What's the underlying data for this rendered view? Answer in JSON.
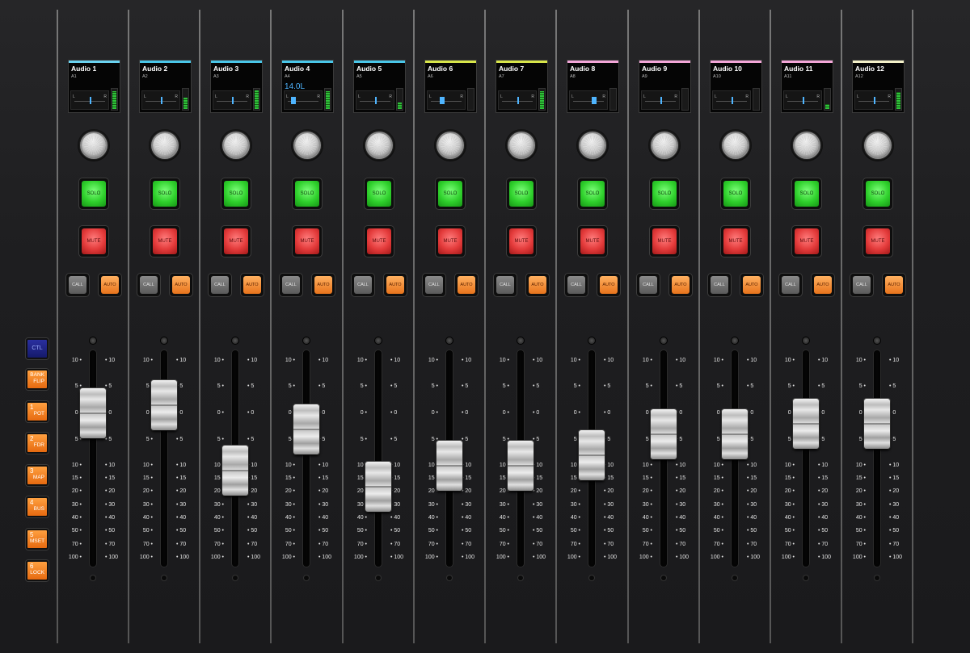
{
  "side_controls": {
    "ctl": "CTL",
    "buttons": [
      {
        "num": "",
        "label": "BANK\nFLIP"
      },
      {
        "num": "1",
        "label": "POT"
      },
      {
        "num": "2",
        "label": "FDR"
      },
      {
        "num": "3",
        "label": "MAP"
      },
      {
        "num": "4",
        "label": "BUS"
      },
      {
        "num": "5",
        "label": "MSET"
      },
      {
        "num": "6",
        "label": "LOCK"
      }
    ]
  },
  "fader_scale": [
    "10",
    "5",
    "0",
    "5",
    "10",
    "15",
    "20",
    "30",
    "40",
    "50",
    "70",
    "100"
  ],
  "labels": {
    "solo": "SOLO",
    "mute": "MUTE",
    "call": "CALL",
    "auto": "AUTO",
    "left": "L",
    "right": "R"
  },
  "channels": [
    {
      "name": "Audio 1",
      "sub": "A1",
      "color": "#6ad3f0",
      "value": "",
      "pan": 0.5,
      "meter": 0.85,
      "fader_db": 0
    },
    {
      "name": "Audio 2",
      "sub": "A2",
      "color": "#49c6e8",
      "value": "",
      "pan": 0.5,
      "meter": 0.55,
      "fader_db": 1.5
    },
    {
      "name": "Audio 3",
      "sub": "A3",
      "color": "#49c6e8",
      "value": "",
      "pan": 0.5,
      "meter": 0.9,
      "fader_db": -12
    },
    {
      "name": "Audio 4",
      "sub": "A4",
      "color": "#49c6e8",
      "value": "14.0L",
      "pan": 0.1,
      "meter": 0.85,
      "fader_db": -3
    },
    {
      "name": "Audio 5",
      "sub": "A5",
      "color": "#49c6e8",
      "value": "",
      "pan": 0.5,
      "meter": 0.3,
      "fader_db": -18
    },
    {
      "name": "Audio 6",
      "sub": "A6",
      "color": "#d8e64a",
      "value": "",
      "pan": 0.3,
      "meter": 0.0,
      "fader_db": -10
    },
    {
      "name": "Audio 7",
      "sub": "A7",
      "color": "#d8e64a",
      "value": "",
      "pan": 0.5,
      "meter": 0.85,
      "fader_db": -10
    },
    {
      "name": "Audio 8",
      "sub": "A8",
      "color": "#f3a6d8",
      "value": "",
      "pan": 0.6,
      "meter": 0.0,
      "fader_db": -8
    },
    {
      "name": "Audio 9",
      "sub": "A9",
      "color": "#f3a6d8",
      "value": "",
      "pan": 0.5,
      "meter": 0.0,
      "fader_db": -4
    },
    {
      "name": "Audio 10",
      "sub": "A10",
      "color": "#f3a6d8",
      "value": "",
      "pan": 0.5,
      "meter": 0.0,
      "fader_db": -4
    },
    {
      "name": "Audio 11",
      "sub": "A11",
      "color": "#f3a6d8",
      "value": "",
      "pan": 0.5,
      "meter": 0.25,
      "fader_db": -2
    },
    {
      "name": "Audio 12",
      "sub": "A12",
      "color": "#f3f0c8",
      "value": "",
      "pan": 0.5,
      "meter": 0.8,
      "fader_db": -2
    }
  ]
}
